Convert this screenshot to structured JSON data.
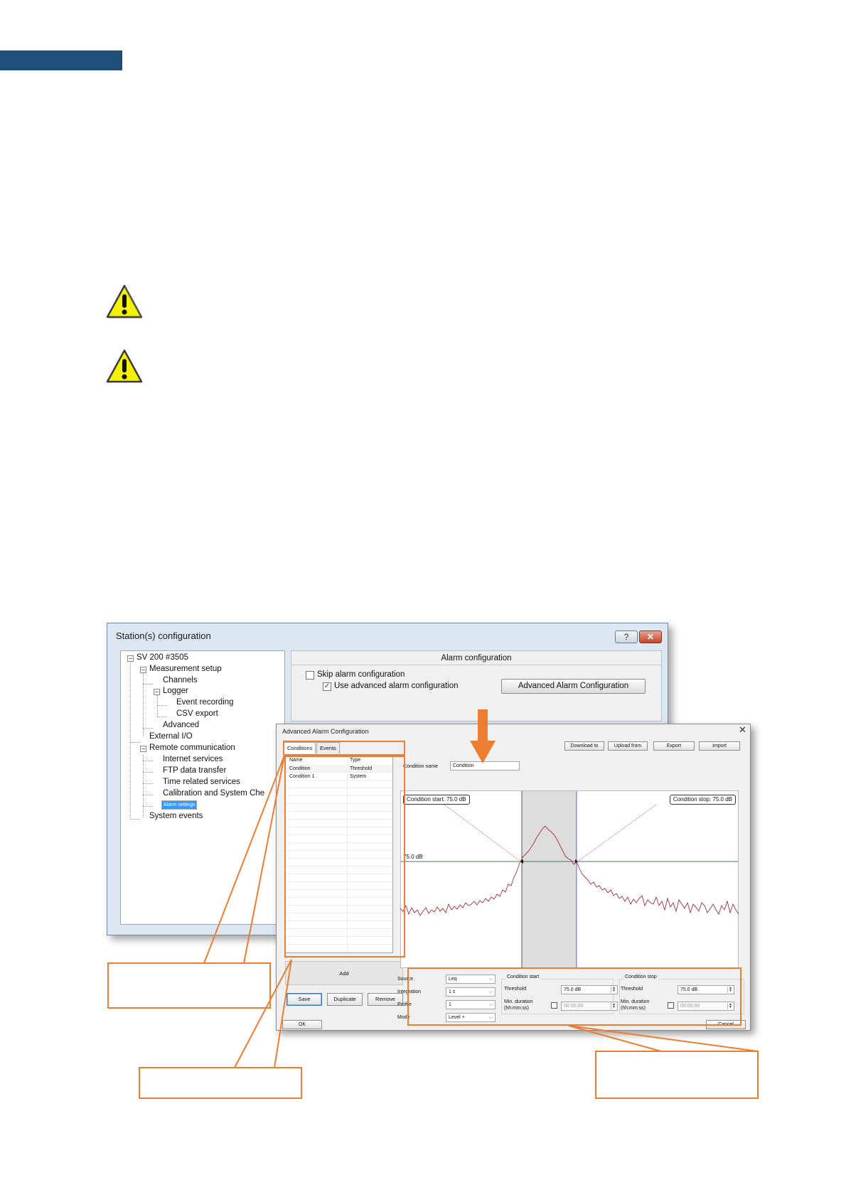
{
  "document": {
    "warning_icon_1": "warning-icon",
    "warning_icon_2": "warning-icon"
  },
  "station_window": {
    "title": "Station(s) configuration",
    "help_button": "?",
    "close_button": "✕",
    "tree": {
      "root": "SV 200 #3505",
      "measurement_setup": "Measurement setup",
      "channels": "Channels",
      "logger": "Logger",
      "event_recording": "Event recording",
      "csv_export": "CSV export",
      "advanced": "Advanced",
      "external_io": "External I/O",
      "remote_communication": "Remote communication",
      "internet_services": "Internet services",
      "ftp_data_transfer": "FTP data transfer",
      "time_related_services": "Time related services",
      "calibration": "Calibration and System Che",
      "alarm_settings": "Alarm settings",
      "system_events": "System events"
    },
    "alarm_panel": {
      "header": "Alarm configuration",
      "skip_label": "Skip alarm configuration",
      "skip_checked": false,
      "use_advanced_label": "Use advanced alarm configuration",
      "use_advanced_checked": true,
      "advanced_button": "Advanced Alarm Configuration"
    }
  },
  "advanced_window": {
    "title": "Advanced Alarm Configuration",
    "close": "✕",
    "tabs": [
      "Conditions",
      "Events"
    ],
    "toolbar": {
      "download": "Download to",
      "upload": "Upload from",
      "export": "Export",
      "import": "Import"
    },
    "list": {
      "col_name": "Name",
      "col_type": "Type",
      "rows": [
        {
          "name": "Condition",
          "type": "Threshold"
        },
        {
          "name": "Condition 1",
          "type": "System"
        }
      ]
    },
    "add_label": "Add",
    "save_label": "Save",
    "duplicate_label": "Duplicate",
    "remove_label": "Remove",
    "ok_label": "OK",
    "cancel_label": "Cancel",
    "condition_name_label": "Condition name",
    "condition_name_value": "Condition",
    "chart": {
      "start_label": "Condition start: 75.0 dB",
      "stop_label": "Condition stop: 75.0 dB",
      "threshold_label": "75.0 dB"
    },
    "settings": {
      "source_label": "Source",
      "source_value": "Leq",
      "integration_label": "Integration",
      "integration_value": "1 s",
      "profile_label": "Profile",
      "profile_value": "1",
      "mode_label": "Mode",
      "mode_value": "Level +",
      "start_group": "Condition start",
      "stop_group": "Condition stop",
      "threshold_label": "Threshold",
      "start_threshold": "75.0 dB",
      "stop_threshold": "75.0 dB",
      "min_duration_label": "Min. duration",
      "min_duration_unit": "(hh:mm:ss)",
      "start_duration": "00:00:00",
      "stop_duration": "00:00:00"
    }
  },
  "colors": {
    "header_bar": "#1f4e79",
    "callout": "#ed7d31",
    "selection": "#3399ff",
    "signal": "#a0303a"
  }
}
